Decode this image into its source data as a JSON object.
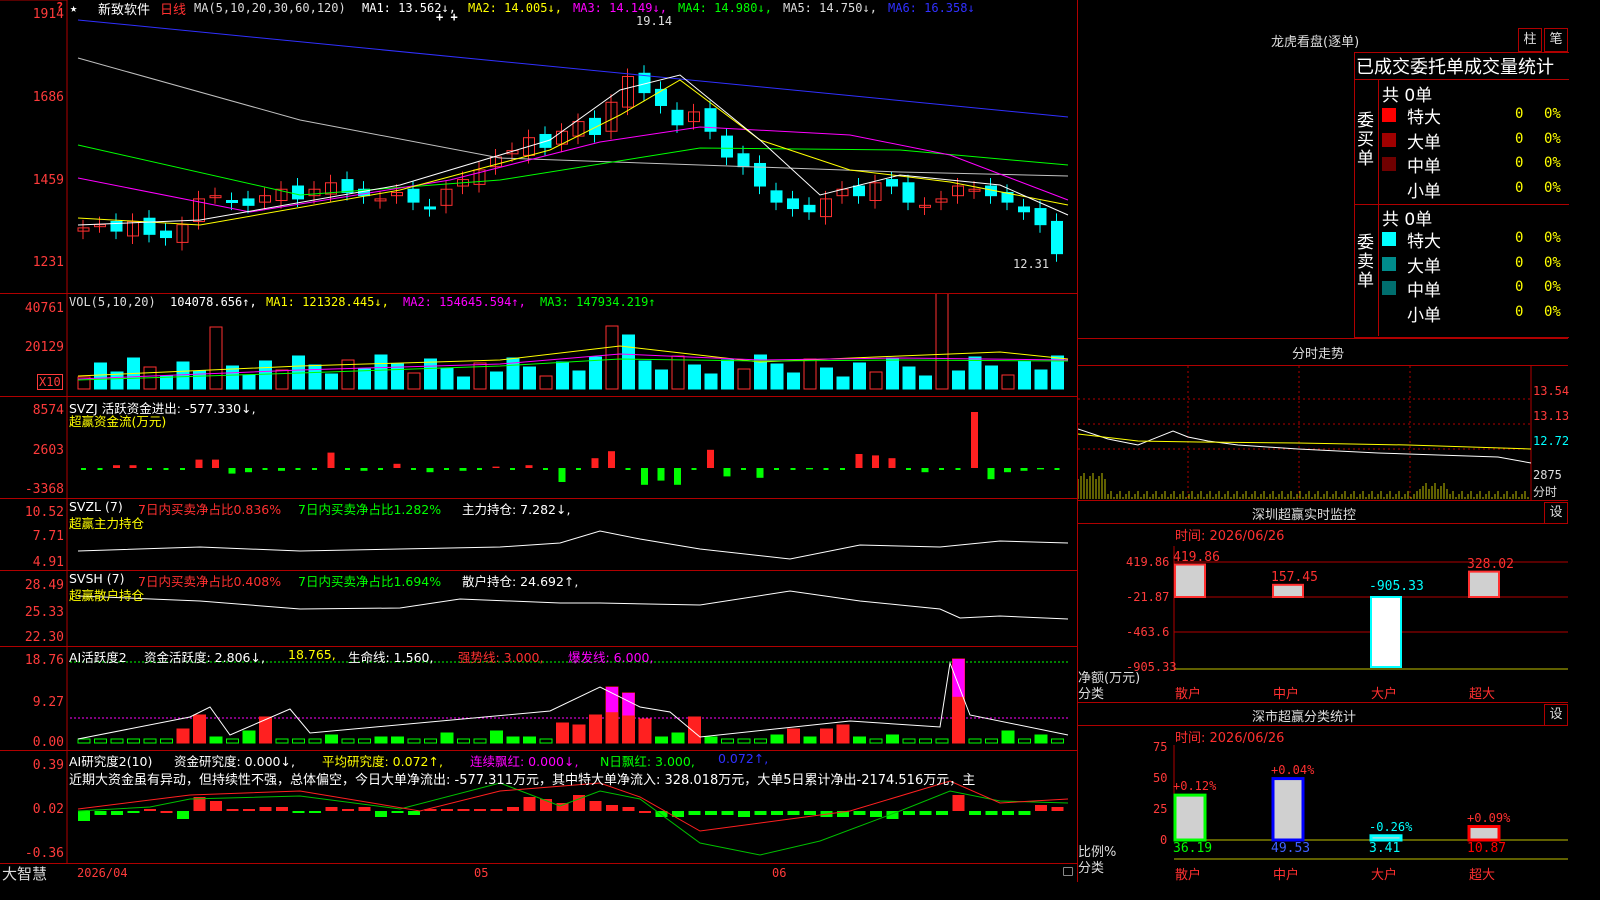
{
  "stock": {
    "name": "新致软件",
    "period": "日线",
    "star": "★",
    "help": "?",
    "ma_title": "MA(5,10,20,30,60,120)",
    "ma1": "MA1: 13.562↓,",
    "ma2": "MA2: 14.005↓,",
    "ma3": "MA3: 14.149↓,",
    "ma4": "MA4: 14.980↓,",
    "ma5": "MA5: 14.750↓,",
    "ma6": "MA6: 16.358↓",
    "high_label": "19.14",
    "low_label": "12.31",
    "plus_marks": "+ +"
  },
  "price_axis": [
    "1914",
    "1686",
    "1459",
    "1231"
  ],
  "vol": {
    "title": "VOL(5,10,20)",
    "value": "104078.656↑,",
    "ma1": "MA1: 121328.445↓,",
    "ma2": "MA2: 154645.594↑,",
    "ma3": "MA3: 147934.219↑",
    "axis": [
      "40761",
      "20129"
    ],
    "unit": "X10"
  },
  "svzj": {
    "title": "SVZJ  活跃资金进出: -577.330↓,",
    "subtitle": "超赢资金流(万元)",
    "axis": [
      "8574",
      "2603",
      "-3368"
    ]
  },
  "svzl": {
    "title": "SVZL (7)",
    "a": "7日内买卖净占比0.836%",
    "b": "7日内买卖净占比1.282%",
    "c": "主力持仓: 7.282↓,",
    "subtitle": "超赢主力持仓",
    "axis": [
      "10.52",
      "7.71",
      "4.91"
    ]
  },
  "svsh": {
    "title": "SVSH (7)",
    "a": "7日内买卖净占比0.408%",
    "b": "7日内买卖净占比1.694%",
    "c": "散户持仓: 24.692↑,",
    "subtitle": "超赢散户持仓",
    "axis": [
      "28.49",
      "25.33",
      "22.30"
    ]
  },
  "ai_act": {
    "title": "AI活跃度2",
    "a": "资金活跃度: 2.806↓,",
    "b": "18.765,",
    "c": "生命线: 1.560,",
    "d": "强势线: 3.000,",
    "e": "爆发线: 6.000,",
    "axis": [
      "18.76",
      "9.27",
      "0.00"
    ]
  },
  "ai_res": {
    "title": "AI研究度2(10)",
    "a": "资金研究度: 0.000↓,",
    "b": "平均研究度: 0.072↑,",
    "c": "连续飘红: 0.000↓,",
    "d": "N日飘红: 3.000,",
    "e": "0.072↑,",
    "text": "近期大资金虽有异动，但持续性不强，总体偏空，今日大单净流出: -577.311万元，其中特大单净流入: 328.018万元，大单5日累计净出-2174.516万元，主",
    "axis": [
      "0.39",
      "0.02",
      "-0.36"
    ]
  },
  "bottom": {
    "brand": "大智慧",
    "date": "2026/04",
    "m5": "05",
    "m6": "06"
  },
  "lhb": {
    "title": "龙虎看盘(逐单)",
    "btn1": "柱",
    "btn2": "笔",
    "heading": "已成交委托单成交量统计",
    "buy_label": "委买单",
    "sell_label": "委卖单",
    "buy_total": "共 0单",
    "sell_total": "共 0单",
    "rows_buy": [
      {
        "name": "特大",
        "n": "0",
        "p": "0%",
        "color": "#ff0000"
      },
      {
        "name": "大单",
        "n": "0",
        "p": "0%",
        "color": "#a00000"
      },
      {
        "name": "中单",
        "n": "0",
        "p": "0%",
        "color": "#700000"
      },
      {
        "name": "小单",
        "n": "0",
        "p": "0%",
        "color": "#000000"
      }
    ],
    "rows_sell": [
      {
        "name": "特大",
        "n": "0",
        "p": "0%",
        "color": "#00ffff"
      },
      {
        "name": "大单",
        "n": "0",
        "p": "0%",
        "color": "#008c8c"
      },
      {
        "name": "中单",
        "n": "0",
        "p": "0%",
        "color": "#006e6e"
      },
      {
        "name": "小单",
        "n": "0",
        "p": "0%",
        "color": "#000000"
      }
    ]
  },
  "intraday": {
    "title": "分时走势",
    "axis": [
      "13.54",
      "13.13",
      "12.72",
      "2875",
      "分时"
    ]
  },
  "sz_monitor": {
    "title": "深圳超赢实时监控",
    "btn": "设",
    "time": "时间: 2026/06/26",
    "axis": [
      "419.86",
      "-21.87",
      "-463.6",
      "-905.33"
    ],
    "ylabel": "净额(万元)",
    "xlabel": "分类",
    "cats": [
      "散户",
      "中户",
      "大户",
      "超大"
    ],
    "values": [
      "419.86",
      "157.45",
      "-905.33",
      "328.02"
    ]
  },
  "sz_class": {
    "title": "深市超赢分类统计",
    "btn": "设",
    "time": "时间: 2026/06/26",
    "axis": [
      "75",
      "50",
      "25",
      "0"
    ],
    "ylabel": "比例%",
    "xlabel": "分类",
    "cats": [
      "散户",
      "中户",
      "大户",
      "超大"
    ],
    "values": [
      "36.19",
      "49.53",
      "3.41",
      "10.87"
    ],
    "changes": [
      "+0.12%",
      "+0.04%",
      "-0.26%",
      "+0.09%"
    ]
  },
  "chart_data": {
    "type": "bar",
    "categories": [
      "散户",
      "中户",
      "大户",
      "超大"
    ],
    "series": [
      {
        "values": [
          419.86,
          157.45,
          -905.33,
          328.02
        ]
      },
      {
        "values": [
          36.19,
          49.53,
          3.41,
          10.87
        ]
      }
    ]
  }
}
